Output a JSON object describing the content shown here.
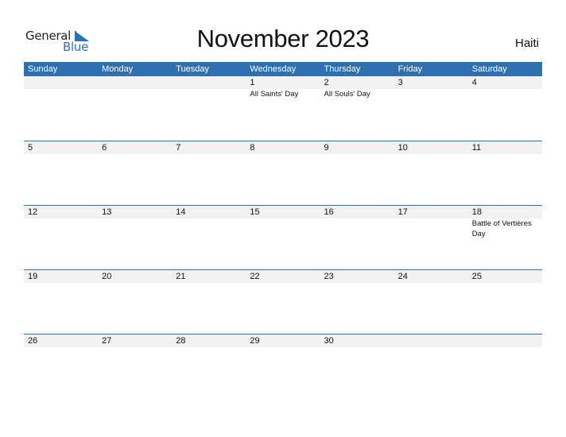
{
  "brand": {
    "line1": "General",
    "line2": "Blue",
    "accent_color": "#2a72b8"
  },
  "header": {
    "title": "November 2023",
    "country": "Haiti"
  },
  "colors": {
    "header_bar": "#2e6fb0",
    "date_strip": "#f2f2f2"
  },
  "weekdays": [
    "Sunday",
    "Monday",
    "Tuesday",
    "Wednesday",
    "Thursday",
    "Friday",
    "Saturday"
  ],
  "weeks": [
    {
      "days": [
        {
          "n": "",
          "h": ""
        },
        {
          "n": "",
          "h": ""
        },
        {
          "n": "",
          "h": ""
        },
        {
          "n": "1",
          "h": "All Saints' Day"
        },
        {
          "n": "2",
          "h": "All Souls' Day"
        },
        {
          "n": "3",
          "h": ""
        },
        {
          "n": "4",
          "h": ""
        }
      ]
    },
    {
      "days": [
        {
          "n": "5",
          "h": ""
        },
        {
          "n": "6",
          "h": ""
        },
        {
          "n": "7",
          "h": ""
        },
        {
          "n": "8",
          "h": ""
        },
        {
          "n": "9",
          "h": ""
        },
        {
          "n": "10",
          "h": ""
        },
        {
          "n": "11",
          "h": ""
        }
      ]
    },
    {
      "days": [
        {
          "n": "12",
          "h": ""
        },
        {
          "n": "13",
          "h": ""
        },
        {
          "n": "14",
          "h": ""
        },
        {
          "n": "15",
          "h": ""
        },
        {
          "n": "16",
          "h": ""
        },
        {
          "n": "17",
          "h": ""
        },
        {
          "n": "18",
          "h": "Battle of Vertières Day"
        }
      ]
    },
    {
      "days": [
        {
          "n": "19",
          "h": ""
        },
        {
          "n": "20",
          "h": ""
        },
        {
          "n": "21",
          "h": ""
        },
        {
          "n": "22",
          "h": ""
        },
        {
          "n": "23",
          "h": ""
        },
        {
          "n": "24",
          "h": ""
        },
        {
          "n": "25",
          "h": ""
        }
      ]
    },
    {
      "days": [
        {
          "n": "26",
          "h": ""
        },
        {
          "n": "27",
          "h": ""
        },
        {
          "n": "28",
          "h": ""
        },
        {
          "n": "29",
          "h": ""
        },
        {
          "n": "30",
          "h": ""
        },
        {
          "n": "",
          "h": ""
        },
        {
          "n": "",
          "h": ""
        }
      ]
    }
  ]
}
